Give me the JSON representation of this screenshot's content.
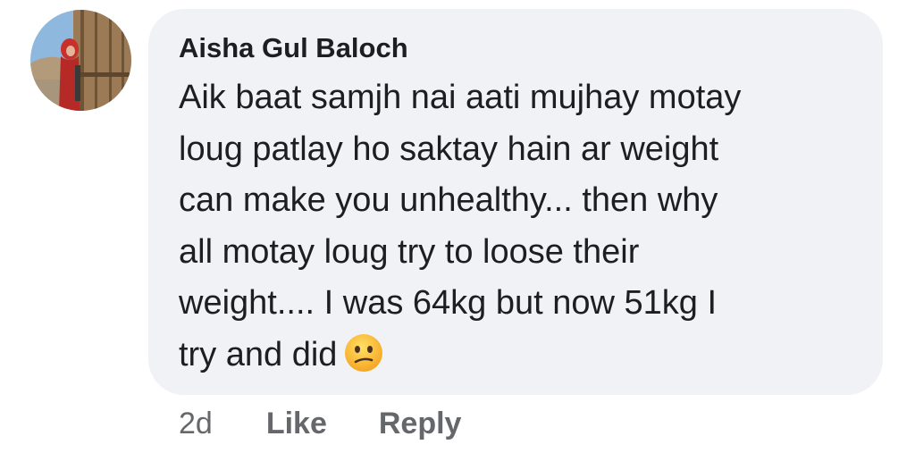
{
  "comment": {
    "author": "Aisha Gul Baloch",
    "lines": [
      "Aik baat samjh nai aati mujhay motay",
      "loug patlay ho saktay hain ar weight",
      "can make you unhealthy... then why",
      "all motay loug try to loose their",
      "weight.... I was 64kg but now 51kg I",
      "try and did"
    ],
    "emoji": "confused-face-emoji",
    "timestamp": "2d",
    "like_label": "Like",
    "reply_label": "Reply"
  },
  "colors": {
    "bubble_bg": "#f0f2f5",
    "text": "#1c1e21",
    "meta": "#65676b"
  }
}
